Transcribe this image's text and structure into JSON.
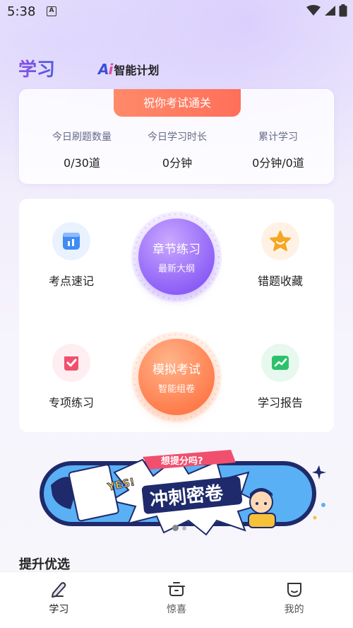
{
  "status_bar": {
    "time": "5:38",
    "notification_icon": "A"
  },
  "header": {
    "title": "学习",
    "logo_mark": "Ai",
    "logo_text": "智能计划"
  },
  "stats": {
    "banner": "祝你考试通关",
    "items": [
      {
        "label": "今日刷题数量",
        "value": "0/30道"
      },
      {
        "label": "今日学习时长",
        "value": "0分钟"
      },
      {
        "label": "累计学习",
        "value": "0分钟/0道"
      }
    ]
  },
  "practice": {
    "features": [
      {
        "label": "考点速记",
        "icon": "notebook-icon",
        "color": "#3f8cf5"
      },
      {
        "label": "错题收藏",
        "icon": "star-icon",
        "color": "#f5a623"
      },
      {
        "label": "专项练习",
        "icon": "checkmark-icon",
        "color": "#f0506e"
      },
      {
        "label": "学习报告",
        "icon": "report-icon",
        "color": "#2dc16b"
      }
    ],
    "chapter": {
      "title": "章节练习",
      "subtitle": "最新大纲"
    },
    "exam": {
      "title": "模拟考试",
      "subtitle": "智能组卷"
    }
  },
  "promo": {
    "bubble": "想提分吗?",
    "yes": "YES!",
    "title": "冲刺密卷",
    "slide_count": 2,
    "active_slide": 1
  },
  "section": {
    "title": "提升优选"
  },
  "tabs": [
    {
      "label": "学习",
      "icon": "pen-icon",
      "active": true
    },
    {
      "label": "惊喜",
      "icon": "gift-box-icon",
      "active": false
    },
    {
      "label": "我的",
      "icon": "profile-icon",
      "active": false
    }
  ],
  "colors": {
    "accent_purple": "#8b5cf6",
    "accent_orange": "#ff7a4a",
    "banner_red": "#ff6f5a"
  }
}
